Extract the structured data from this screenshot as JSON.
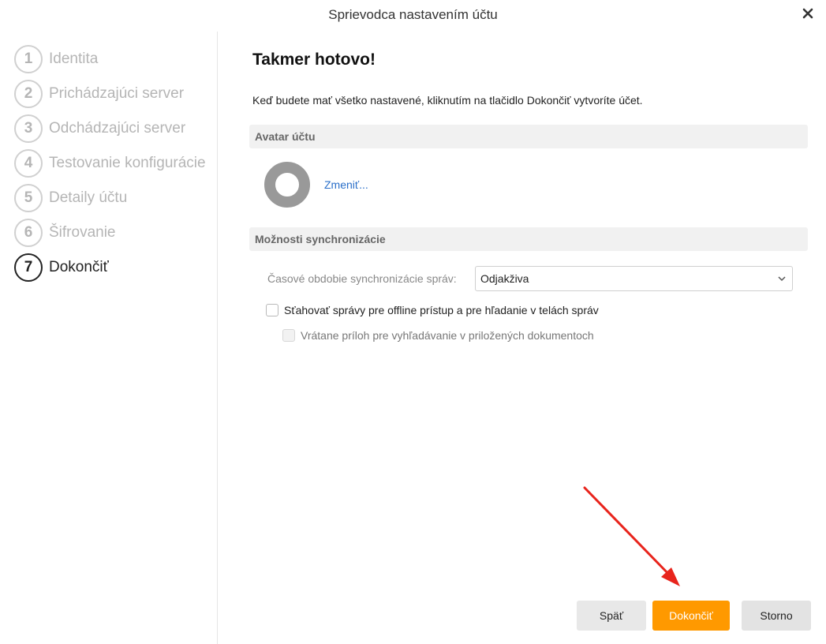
{
  "window": {
    "title": "Sprievodca nastavením účtu",
    "close_icon": "close-icon"
  },
  "sidebar": {
    "steps": [
      {
        "number": "1",
        "label": "Identita",
        "active": false
      },
      {
        "number": "2",
        "label": "Prichádzajúci server",
        "active": false
      },
      {
        "number": "3",
        "label": "Odchádzajúci server",
        "active": false
      },
      {
        "number": "4",
        "label": "Testovanie konfigurácie",
        "active": false
      },
      {
        "number": "5",
        "label": "Detaily účtu",
        "active": false
      },
      {
        "number": "6",
        "label": "Šifrovanie",
        "active": false
      },
      {
        "number": "7",
        "label": "Dokončiť",
        "active": true
      }
    ]
  },
  "main": {
    "heading": "Takmer hotovo!",
    "description": "Keď budete mať všetko nastavené, kliknutím na tlačidlo Dokončiť vytvoríte účet.",
    "avatar_section": {
      "header": "Avatar účtu",
      "change_link": "Zmeniť..."
    },
    "sync_section": {
      "header": "Možnosti synchronizácie",
      "period_label": "Časové obdobie synchronizácie správ:",
      "period_value": "Odjakživa",
      "offline_checkbox": {
        "label": "Sťahovať správy pre offline prístup a pre hľadanie v telách správ",
        "checked": false
      },
      "attachments_checkbox": {
        "label": "Vrátane príloh pre vyhľadávanie v priložených dokumentoch",
        "checked": false,
        "disabled": true
      }
    }
  },
  "footer": {
    "back_label": "Späť",
    "finish_label": "Dokončiť",
    "cancel_label": "Storno"
  },
  "colors": {
    "accent": "#ff9900",
    "link": "#2a6fc9",
    "annotation_arrow": "#e8241c"
  }
}
